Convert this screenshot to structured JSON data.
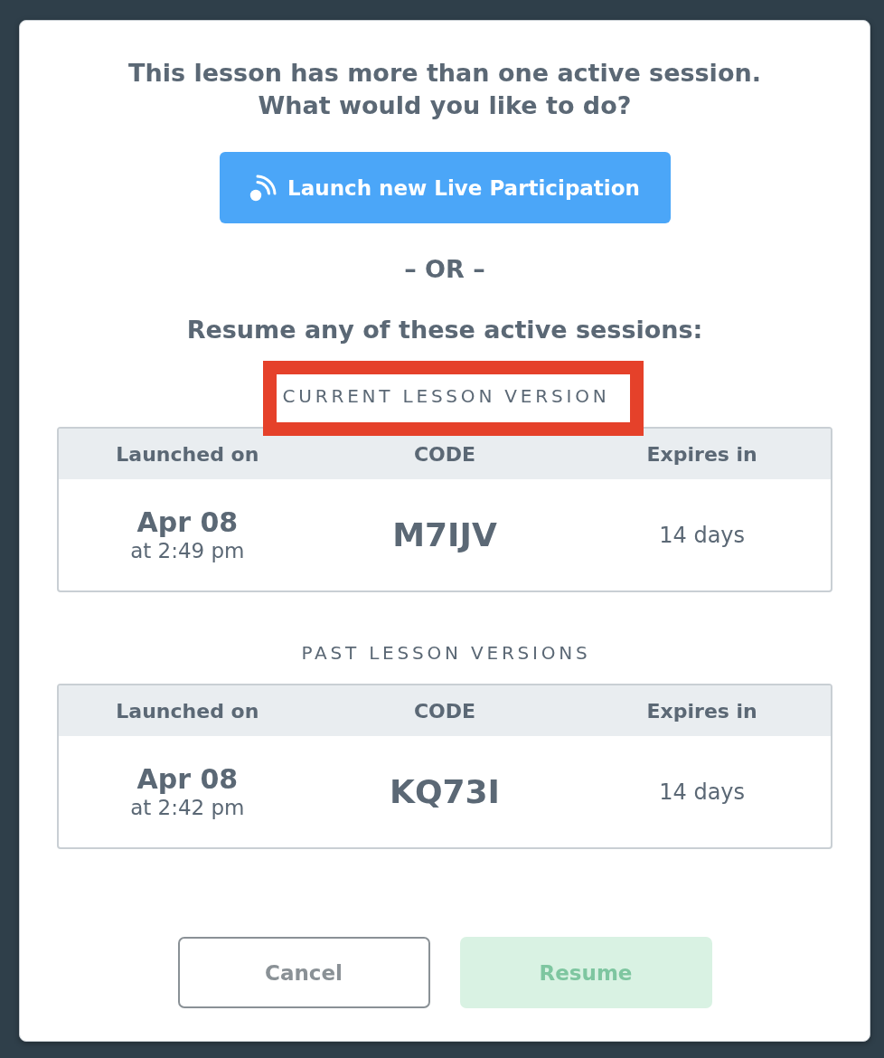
{
  "dialog": {
    "title_lines": [
      "This lesson has more than one active session.",
      "What would you like to do?"
    ],
    "launch_button": {
      "label": "Launch new Live Participation"
    },
    "separator": "– OR –",
    "resume_prompt": "Resume any of these active sessions:",
    "session_groups": [
      {
        "heading": "CURRENT LESSON VERSION",
        "highlighted": true,
        "columns": [
          "Launched on",
          "CODE",
          "Expires in"
        ],
        "rows": [
          {
            "date": "Apr 08",
            "time": "at 2:49 pm",
            "code": "M7IJV",
            "expires": "14 days"
          }
        ]
      },
      {
        "heading": "PAST LESSON VERSIONS",
        "highlighted": false,
        "columns": [
          "Launched on",
          "CODE",
          "Expires in"
        ],
        "rows": [
          {
            "date": "Apr 08",
            "time": "at 2:42 pm",
            "code": "KQ73I",
            "expires": "14 days"
          }
        ]
      }
    ],
    "buttons": [
      {
        "label": "Cancel",
        "kind": "outline",
        "disabled": false
      },
      {
        "label": "Resume",
        "kind": "primary",
        "disabled": true
      }
    ]
  }
}
